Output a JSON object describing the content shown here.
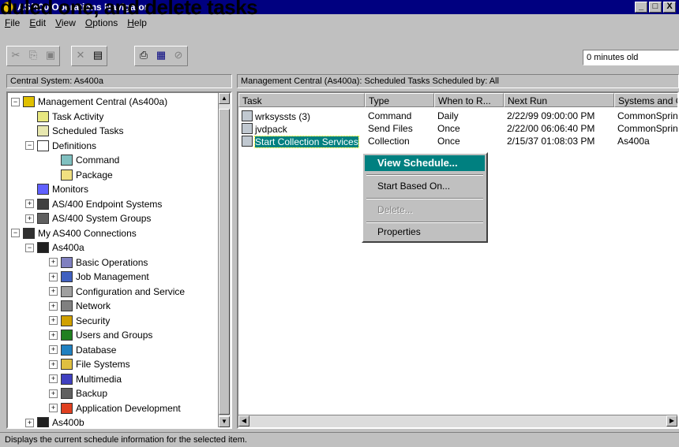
{
  "overlay_title": "duled one, and delete tasks",
  "window": {
    "title": "AS/400 Operations Navigator",
    "btns": [
      "_",
      "□",
      "X"
    ]
  },
  "menubar": [
    {
      "label": "File",
      "key": "F"
    },
    {
      "label": "Edit",
      "key": "E"
    },
    {
      "label": "View",
      "key": "V"
    },
    {
      "label": "Options",
      "key": "O"
    },
    {
      "label": "Help",
      "key": "H"
    }
  ],
  "toolbar": {
    "buttons": [
      "cut-icon",
      "copy-icon",
      "paste-icon",
      "delete-icon",
      "properties-icon",
      "print-icon",
      "view-icon",
      "stop-icon"
    ],
    "age_text": "0 minutes old"
  },
  "left_header": "Central System: As400a",
  "right_header": "Management Central (As400a):  Scheduled Tasks    Scheduled by:  All",
  "tree": [
    {
      "label": "Management Central (As400a)",
      "expander": "−",
      "depth": 0,
      "icon": "mgmt-central-icon",
      "color": "#e0c000"
    },
    {
      "label": "Task Activity",
      "expander": "",
      "depth": 1,
      "icon": "task-activity-icon",
      "color": "#e8e880"
    },
    {
      "label": "Scheduled Tasks",
      "expander": "",
      "depth": 1,
      "icon": "scheduled-tasks-icon",
      "color": "#e8e8b0"
    },
    {
      "label": "Definitions",
      "expander": "−",
      "depth": 1,
      "icon": "definitions-icon",
      "color": "#ffffff"
    },
    {
      "label": "Command",
      "expander": "",
      "depth": 2,
      "icon": "command-icon",
      "color": "#80c0c0"
    },
    {
      "label": "Package",
      "expander": "",
      "depth": 2,
      "icon": "package-icon",
      "color": "#f0e080"
    },
    {
      "label": "Monitors",
      "expander": "",
      "depth": 1,
      "icon": "monitors-icon",
      "color": "#6060ff"
    },
    {
      "label": "AS/400 Endpoint Systems",
      "expander": "+",
      "depth": 1,
      "icon": "endpoint-systems-icon",
      "color": "#404040"
    },
    {
      "label": "AS/400 System Groups",
      "expander": "+",
      "depth": 1,
      "icon": "system-groups-icon",
      "color": "#606060"
    },
    {
      "label": "My AS400 Connections",
      "expander": "−",
      "depth": 0,
      "icon": "connections-icon",
      "color": "#303030"
    },
    {
      "label": "As400a",
      "expander": "−",
      "depth": 1,
      "icon": "server-icon",
      "color": "#202020"
    },
    {
      "label": "Basic Operations",
      "expander": "+",
      "depth": 2,
      "icon": "basic-operations-icon",
      "color": "#8080c0"
    },
    {
      "label": "Job Management",
      "expander": "+",
      "depth": 2,
      "icon": "job-management-icon",
      "color": "#4060c0"
    },
    {
      "label": "Configuration and Service",
      "expander": "+",
      "depth": 2,
      "icon": "config-service-icon",
      "color": "#a0a0a0"
    },
    {
      "label": "Network",
      "expander": "+",
      "depth": 2,
      "icon": "network-icon",
      "color": "#808080"
    },
    {
      "label": "Security",
      "expander": "+",
      "depth": 2,
      "icon": "security-icon",
      "color": "#d0a000"
    },
    {
      "label": "Users and Groups",
      "expander": "+",
      "depth": 2,
      "icon": "users-groups-icon",
      "color": "#208020"
    },
    {
      "label": "Database",
      "expander": "+",
      "depth": 2,
      "icon": "database-icon",
      "color": "#2080c0"
    },
    {
      "label": "File Systems",
      "expander": "+",
      "depth": 2,
      "icon": "file-systems-icon",
      "color": "#e0c040"
    },
    {
      "label": "Multimedia",
      "expander": "+",
      "depth": 2,
      "icon": "multimedia-icon",
      "color": "#4040c0"
    },
    {
      "label": "Backup",
      "expander": "+",
      "depth": 2,
      "icon": "backup-icon",
      "color": "#606060"
    },
    {
      "label": "Application Development",
      "expander": "+",
      "depth": 2,
      "icon": "app-development-icon",
      "color": "#e04020"
    },
    {
      "label": "As400b",
      "expander": "+",
      "depth": 1,
      "icon": "server-icon",
      "color": "#202020"
    }
  ],
  "columns": [
    "Task",
    "Type",
    "When to R...",
    "Next Run",
    "Systems and G"
  ],
  "rows": [
    {
      "task": "wrksyssts (3)",
      "type": "Command",
      "when": "Daily",
      "next": "2/22/99 09:00:00 PM",
      "systems": "CommonSpring",
      "icon": "command-task-icon"
    },
    {
      "task": "jvdpack",
      "type": "Send Files",
      "when": "Once",
      "next": "2/22/00 06:06:40 PM",
      "systems": "CommonSpring",
      "icon": "package-task-icon"
    },
    {
      "task": "Start Collection Services",
      "type": "Collection",
      "when": "Once",
      "next": "2/15/37 01:08:03 PM",
      "systems": "As400a",
      "icon": "collection-task-icon"
    }
  ],
  "context_menu": {
    "view_schedule": "View Schedule...",
    "start_based_on": "Start Based On...",
    "delete": "Delete...",
    "properties": "Properties"
  },
  "status": "Displays the current schedule information for the selected item."
}
